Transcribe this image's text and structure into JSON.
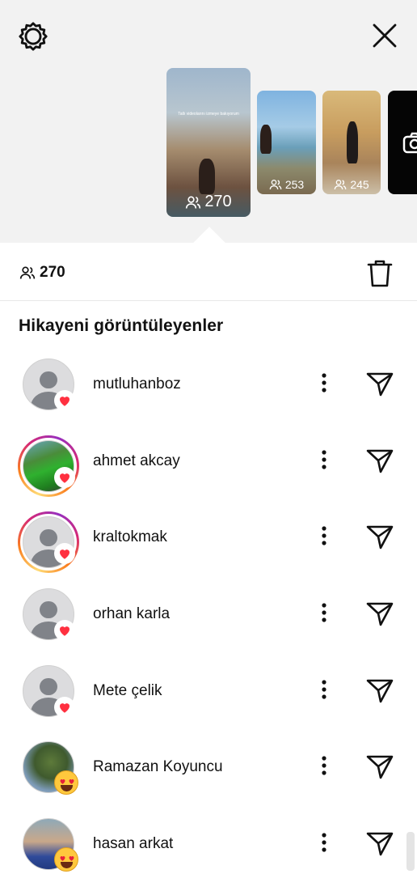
{
  "stories": [
    {
      "count": "270",
      "caption": "Tatlı videolarını izmeye bakıyorum"
    },
    {
      "count": "253"
    },
    {
      "count": "245"
    }
  ],
  "stats": {
    "viewers": "270"
  },
  "section_title": "Hikayeni görüntüleyenler",
  "viewers": [
    {
      "name": "mutluhanboz",
      "reaction": "heart",
      "avatar": "default-avatar"
    },
    {
      "name": "ahmet akcay",
      "reaction": "heart",
      "avatar": "green-car-photo"
    },
    {
      "name": "kraltokmak",
      "reaction": "heart",
      "avatar": "default-avatar"
    },
    {
      "name": "orhan karla",
      "reaction": "heart",
      "avatar": "default-avatar"
    },
    {
      "name": "Mete çelik",
      "reaction": "heart",
      "avatar": "default-avatar"
    },
    {
      "name": "Ramazan Koyuncu",
      "reaction": "heart-eyes-emoji",
      "avatar": "tree-photo"
    },
    {
      "name": "hasan arkat",
      "reaction": "heart-eyes-emoji",
      "avatar": "man-photo"
    }
  ],
  "colors": {
    "heart": "#ff3040",
    "icon": "#111111",
    "header_bg": "#f2f2f2"
  }
}
